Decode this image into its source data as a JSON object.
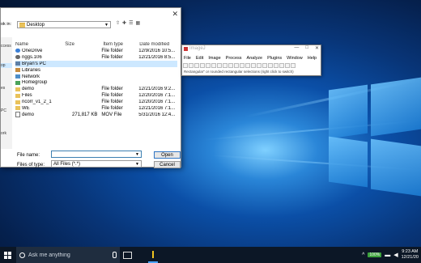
{
  "dialog": {
    "look_in_label": "ok in:",
    "path_value": "Desktop",
    "columns": [
      "Name",
      "Size",
      "Item type",
      "Date modified"
    ],
    "files": [
      {
        "icon": "cloud",
        "name": "OneDrive",
        "size": "",
        "type": "File folder",
        "date": "12/9/2016 10:5..."
      },
      {
        "icon": "user",
        "name": "riggs.106",
        "size": "",
        "type": "File folder",
        "date": "12/21/2016 8:5..."
      },
      {
        "icon": "pc",
        "name": "Bryan's PC",
        "size": "",
        "type": "",
        "date": ""
      },
      {
        "icon": "lib",
        "name": "Libraries",
        "size": "",
        "type": "",
        "date": ""
      },
      {
        "icon": "net",
        "name": "Network",
        "size": "",
        "type": "",
        "date": ""
      },
      {
        "icon": "home",
        "name": "Homegroup",
        "size": "",
        "type": "",
        "date": ""
      },
      {
        "icon": "folder",
        "name": "demo",
        "size": "",
        "type": "File folder",
        "date": "12/21/2016 9:2..."
      },
      {
        "icon": "folder",
        "name": "Files",
        "size": "",
        "type": "File folder",
        "date": "12/20/2016 7:1..."
      },
      {
        "icon": "folder",
        "name": "ricorr_v1_2_1",
        "size": "",
        "type": "File folder",
        "date": "12/20/2016 7:1..."
      },
      {
        "icon": "folder",
        "name": "WE",
        "size": "",
        "type": "File folder",
        "date": "12/21/2016 7:1..."
      },
      {
        "icon": "movie",
        "name": "demo",
        "size": "271,817 KB",
        "type": "MOV File",
        "date": "5/31/2016 12:4..."
      }
    ],
    "places": [
      "ccess",
      "op",
      "es",
      "PC",
      "ork"
    ],
    "file_name_label": "File name:",
    "file_name_value": "",
    "files_of_type_label": "Files of type:",
    "files_of_type_value": "All Files (*.*)",
    "open_label": "Open",
    "cancel_label": "Cancel",
    "close_glyph": "✕"
  },
  "imagej": {
    "title": "ImageJ",
    "menu": [
      "File",
      "Edit",
      "Image",
      "Process",
      "Analyze",
      "Plugins",
      "Window",
      "Help"
    ],
    "status": "Rectangular\" or rounded rectangular selections (right click to switch)",
    "controls": [
      "—",
      "□",
      "✕"
    ]
  },
  "taskbar": {
    "search_placeholder": "Ask me anything",
    "battery": "100%",
    "time": "9:23 AM",
    "date": "12/21/20"
  }
}
